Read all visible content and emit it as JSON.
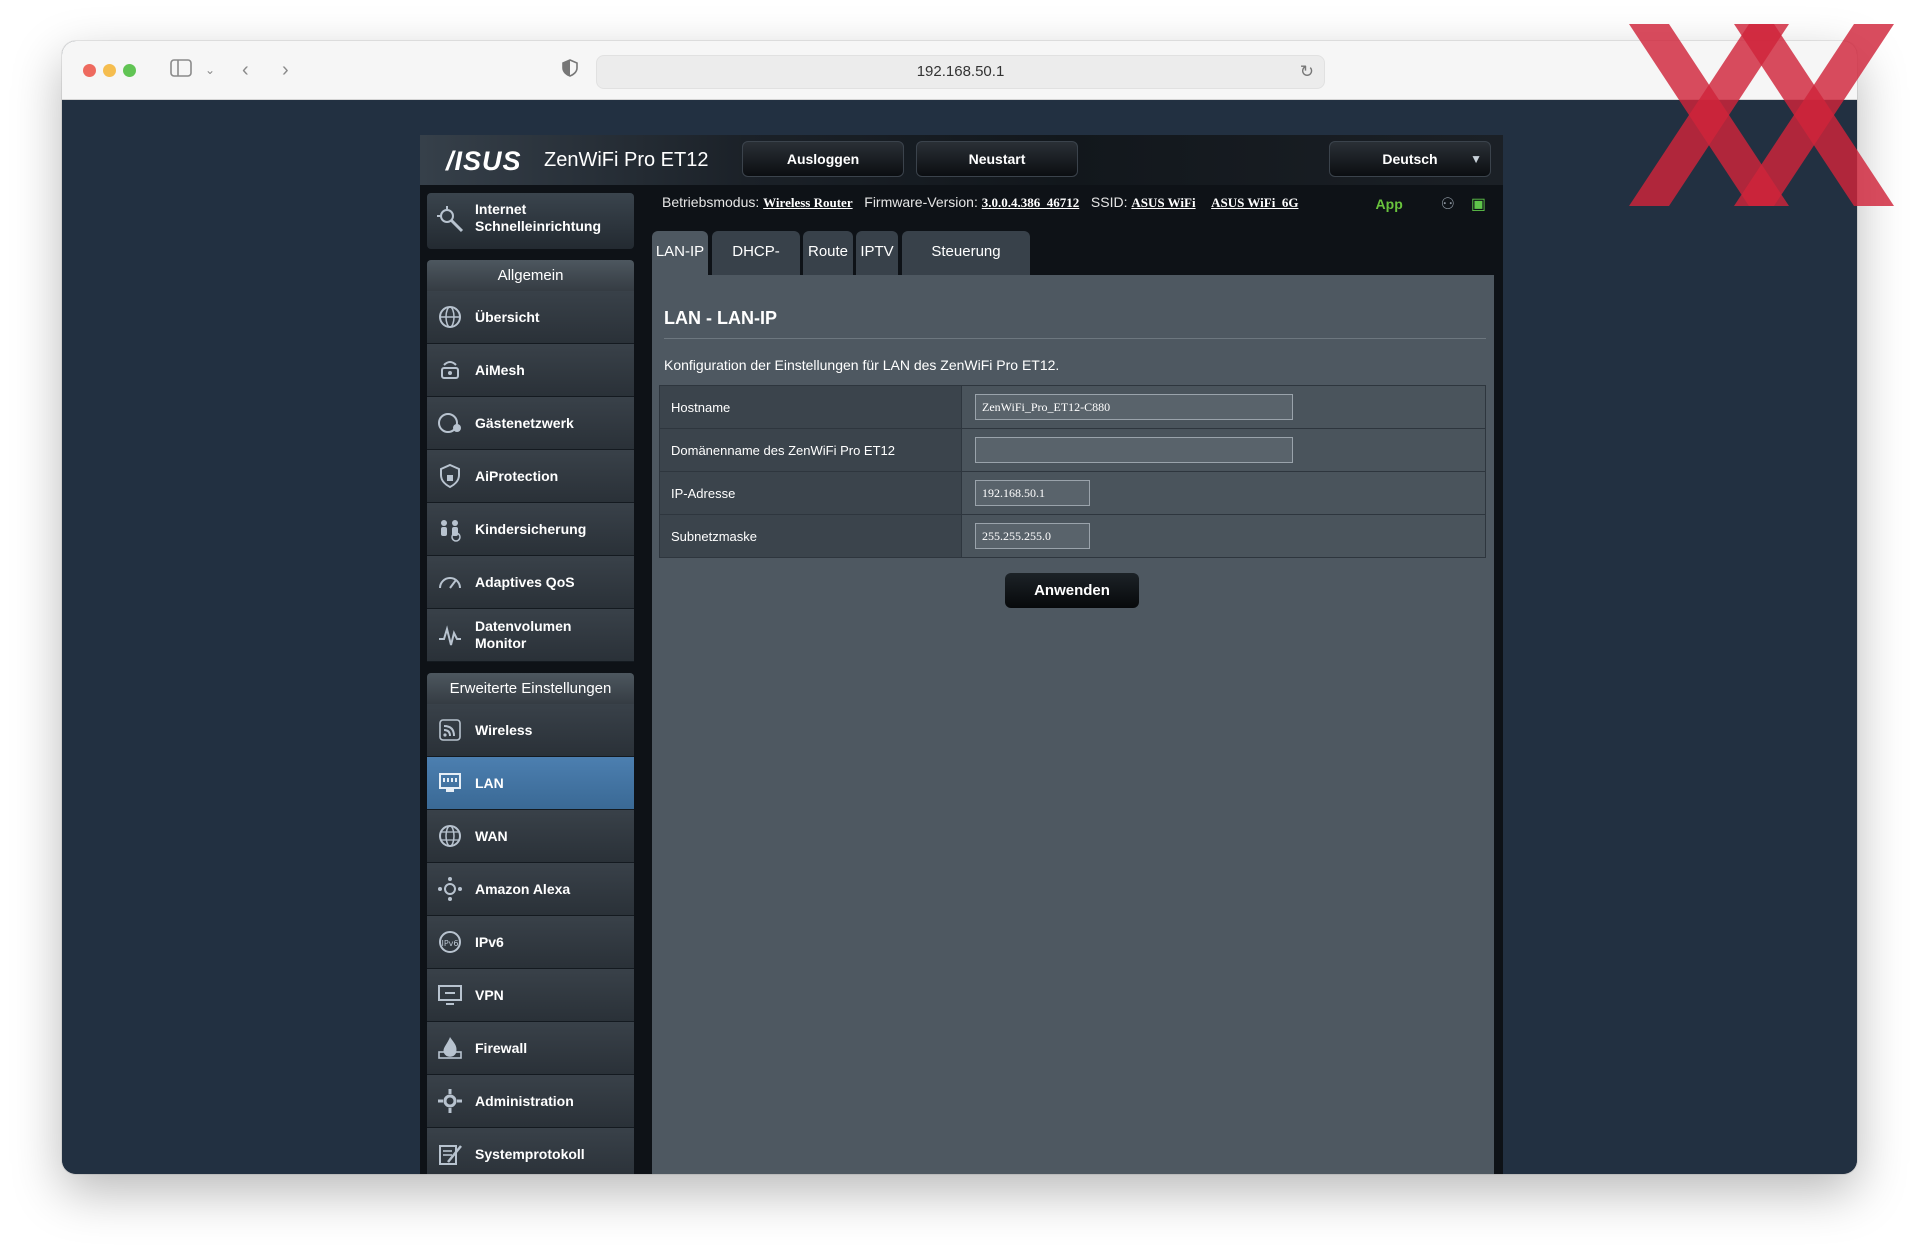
{
  "browser": {
    "url": "192.168.50.1"
  },
  "header": {
    "brand": "/ISUS",
    "model": "ZenWiFi Pro ET12",
    "logout_label": "Ausloggen",
    "reboot_label": "Neustart",
    "language": "Deutsch"
  },
  "status": {
    "mode_label": "Betriebsmodus:",
    "mode_value": "Wireless Router",
    "firmware_label": "Firmware-Version:",
    "firmware_value": "3.0.0.4.386_46712",
    "ssid_label": "SSID:",
    "ssid_1": "ASUS WiFi",
    "ssid_2": "ASUS WiFi_6G",
    "app_label": "App",
    "colors": {
      "app": "#69c33d",
      "active_menu": "#4c7fb0"
    }
  },
  "sidebar": {
    "quick_setup": "Internet\nSchnelleinrichtung",
    "general_title": "Allgemein",
    "general_items": [
      {
        "label": "Übersicht",
        "icon": "globe-network-icon"
      },
      {
        "label": "AiMesh",
        "icon": "aimesh-router-icon"
      },
      {
        "label": "Gästenetzwerk",
        "icon": "guest-network-icon"
      },
      {
        "label": "AiProtection",
        "icon": "shield-lock-icon"
      },
      {
        "label": "Kindersicherung",
        "icon": "family-icon"
      },
      {
        "label": "Adaptives QoS",
        "icon": "speedometer-icon"
      },
      {
        "label": "Datenvolumen\nMonitor",
        "icon": "traffic-monitor-icon"
      }
    ],
    "advanced_title": "Erweiterte Einstellungen",
    "advanced_items": [
      {
        "label": "Wireless",
        "icon": "wireless-icon"
      },
      {
        "label": "LAN",
        "icon": "lan-icon"
      },
      {
        "label": "WAN",
        "icon": "wan-globe-icon"
      },
      {
        "label": "Amazon Alexa",
        "icon": "alexa-icon"
      },
      {
        "label": "IPv6",
        "icon": "ipv6-icon"
      },
      {
        "label": "VPN",
        "icon": "vpn-monitor-icon"
      },
      {
        "label": "Firewall",
        "icon": "firewall-flame-icon"
      },
      {
        "label": "Administration",
        "icon": "admin-gear-icon"
      },
      {
        "label": "Systemprotokoll",
        "icon": "system-log-icon"
      }
    ],
    "active_item": "LAN"
  },
  "tabs": [
    "LAN-IP",
    "DHCP-Server",
    "Route",
    "IPTV",
    "Steuerung wechseln"
  ],
  "main": {
    "title": "LAN - LAN-IP",
    "description": "Konfiguration der Einstellungen für LAN des ZenWiFi Pro ET12.",
    "fields": [
      {
        "label": "Hostname",
        "value": "ZenWiFi_Pro_ET12-C880"
      },
      {
        "label": "Domänenname des ZenWiFi Pro ET12",
        "value": ""
      },
      {
        "label": "IP-Adresse",
        "value": "192.168.50.1"
      },
      {
        "label": "Subnetzmaske",
        "value": "255.255.255.0"
      }
    ],
    "apply_label": "Anwenden"
  }
}
